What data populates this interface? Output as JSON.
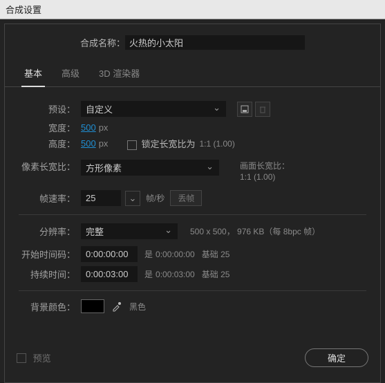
{
  "window": {
    "title": "合成设置"
  },
  "compName": {
    "label": "合成名称：",
    "value": "火热的小太阳"
  },
  "tabs": {
    "basic": "基本",
    "advanced": "高级",
    "renderer": "3D 渲染器"
  },
  "preset": {
    "label": "预设：",
    "value": "自定义"
  },
  "width": {
    "label": "宽度：",
    "value": "500",
    "unit": "px"
  },
  "height": {
    "label": "高度：",
    "value": "500",
    "unit": "px"
  },
  "lockAspect": {
    "label": "锁定长宽比为",
    "ratio": "1:1 (1.00)"
  },
  "par": {
    "label": "像素长宽比：",
    "value": "方形像素"
  },
  "frameAspect": {
    "label": "画面长宽比：",
    "value": "1:1 (1.00)"
  },
  "fps": {
    "label": "帧速率：",
    "value": "25",
    "unit": "帧/秒",
    "drop": "丢帧"
  },
  "resolution": {
    "label": "分辨率：",
    "value": "完整",
    "info": "500 x 500， 976 KB（每 8bpc 帧）"
  },
  "startTC": {
    "label": "开始时间码：",
    "value": "0:00:00:00",
    "is": "是",
    "isVal": "0:00:00:00",
    "base": "基础 25"
  },
  "duration": {
    "label": "持续时间：",
    "value": "0:00:03:00",
    "is": "是",
    "isVal": "0:00:03:00",
    "base": "基础 25"
  },
  "bg": {
    "label": "背景颜色：",
    "name": "黑色",
    "hex": "#000000"
  },
  "footer": {
    "preview": "预览",
    "ok": "确定"
  }
}
